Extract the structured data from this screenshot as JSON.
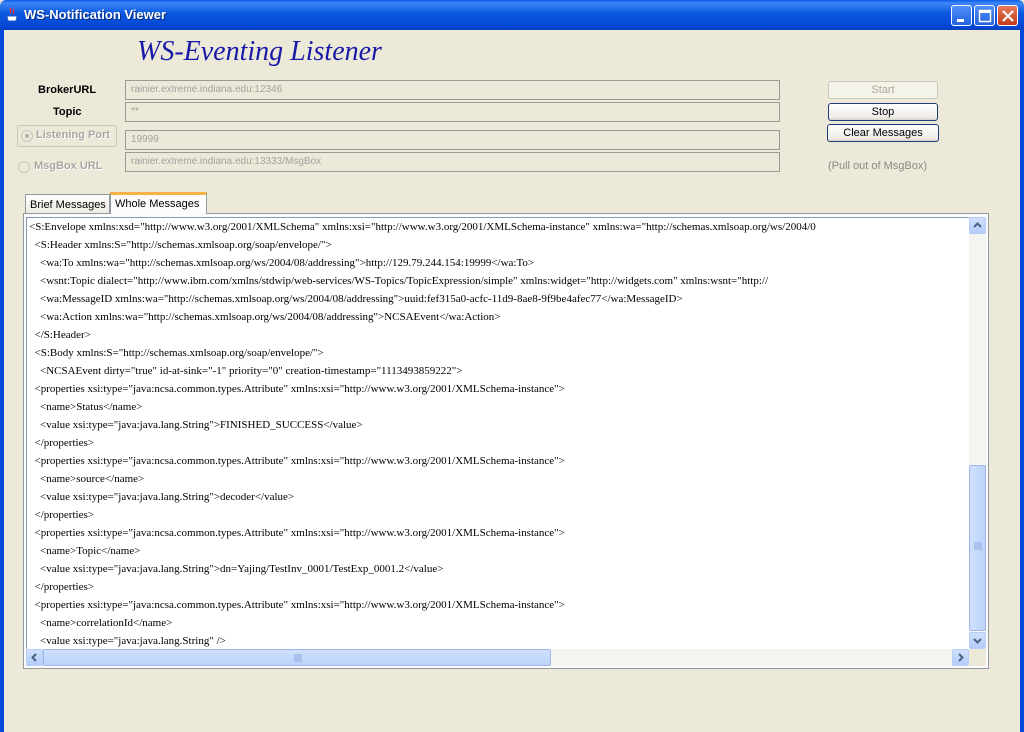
{
  "window": {
    "title": "WS-Notification Viewer"
  },
  "heading": "WS-Eventing Listener",
  "form": {
    "broker_url_label": "BrokerURL",
    "broker_url_value": "rainier.extreme.indiana.edu:12346",
    "topic_label": "Topic",
    "topic_value": "**",
    "listening_port_label": "Listening Port",
    "listening_port_value": "19999",
    "msgbox_url_label": "MsgBox URL",
    "msgbox_url_value": "rainier.extreme.indiana.edu:13333/MsgBox"
  },
  "buttons": {
    "start": "Start",
    "stop": "Stop",
    "clear": "Clear Messages"
  },
  "pull_note": "(Pull out of MsgBox)",
  "tabs": [
    {
      "label": "Brief Messages",
      "active": false
    },
    {
      "label": "Whole Messages",
      "active": true
    }
  ],
  "messages": [
    "<S:Envelope xmlns:xsd=\"http://www.w3.org/2001/XMLSchema\" xmlns:xsi=\"http://www.w3.org/2001/XMLSchema-instance\" xmlns:wa=\"http://schemas.xmlsoap.org/ws/2004/0",
    "  <S:Header xmlns:S=\"http://schemas.xmlsoap.org/soap/envelope/\">",
    "    <wa:To xmlns:wa=\"http://schemas.xmlsoap.org/ws/2004/08/addressing\">http://129.79.244.154:19999</wa:To>",
    "    <wsnt:Topic dialect=\"http://www.ibm.com/xmlns/stdwip/web-services/WS-Topics/TopicExpression/simple\" xmlns:widget=\"http://widgets.com\" xmlns:wsnt=\"http://",
    "    <wa:MessageID xmlns:wa=\"http://schemas.xmlsoap.org/ws/2004/08/addressing\">uuid:fef315a0-acfc-11d9-8ae8-9f9be4afec77</wa:MessageID>",
    "    <wa:Action xmlns:wa=\"http://schemas.xmlsoap.org/ws/2004/08/addressing\">NCSAEvent</wa:Action>",
    "  </S:Header>",
    "  <S:Body xmlns:S=\"http://schemas.xmlsoap.org/soap/envelope/\">",
    "    <NCSAEvent dirty=\"true\" id-at-sink=\"-1\" priority=\"0\" creation-timestamp=\"1113493859222\">",
    "  <properties xsi:type=\"java:ncsa.common.types.Attribute\" xmlns:xsi=\"http://www.w3.org/2001/XMLSchema-instance\">",
    "    <name>Status</name>",
    "    <value xsi:type=\"java:java.lang.String\">FINISHED_SUCCESS</value>",
    "  </properties>",
    "  <properties xsi:type=\"java:ncsa.common.types.Attribute\" xmlns:xsi=\"http://www.w3.org/2001/XMLSchema-instance\">",
    "    <name>source</name>",
    "    <value xsi:type=\"java:java.lang.String\">decoder</value>",
    "  </properties>",
    "  <properties xsi:type=\"java:ncsa.common.types.Attribute\" xmlns:xsi=\"http://www.w3.org/2001/XMLSchema-instance\">",
    "    <name>Topic</name>",
    "    <value xsi:type=\"java:java.lang.String\">dn=Yajing/TestInv_0001/TestExp_0001.2</value>",
    "  </properties>",
    "  <properties xsi:type=\"java:ncsa.common.types.Attribute\" xmlns:xsi=\"http://www.w3.org/2001/XMLSchema-instance\">",
    "    <name>correlationId</name>",
    "    <value xsi:type=\"java:java.lang.String\" />"
  ],
  "icons": {
    "app": "java-cup-icon",
    "minimize": "minimize-icon",
    "maximize": "maximize-icon",
    "close": "close-icon"
  },
  "colors": {
    "titlebar": "#0a57e0",
    "heading": "#1a1aa8",
    "active_tab_accent": "#f7b247"
  }
}
